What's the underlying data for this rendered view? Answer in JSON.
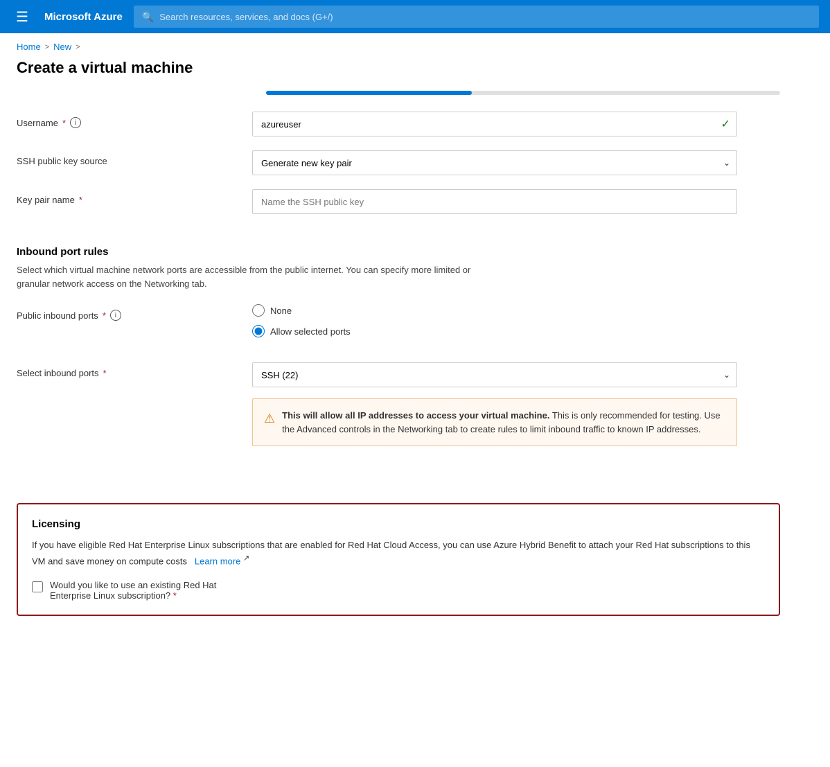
{
  "navbar": {
    "hamburger_label": "☰",
    "brand": "Microsoft Azure",
    "search_placeholder": "Search resources, services, and docs (G+/)"
  },
  "breadcrumb": {
    "home": "Home",
    "new": "New",
    "sep1": ">",
    "sep2": ">"
  },
  "page": {
    "title": "Create a virtual machine"
  },
  "form": {
    "username_label": "Username",
    "username_value": "azureuser",
    "ssh_source_label": "SSH public key source",
    "ssh_source_value": "Generate new key pair",
    "key_pair_label": "Key pair name",
    "key_pair_placeholder": "Name the SSH public key",
    "inbound_section_heading": "Inbound port rules",
    "inbound_description": "Select which virtual machine network ports are accessible from the public internet. You can specify more limited or granular network access on the Networking tab.",
    "public_inbound_label": "Public inbound ports",
    "radio_none": "None",
    "radio_allow": "Allow selected ports",
    "select_inbound_label": "Select inbound ports",
    "select_inbound_value": "SSH (22)",
    "warning_text_bold": "This will allow all IP addresses to access your virtual machine.",
    "warning_text": " This is only recommended for testing.  Use the Advanced controls in the Networking tab to create rules to limit inbound traffic to known IP addresses.",
    "licensing_title": "Licensing",
    "licensing_description": "If you have eligible Red Hat Enterprise Linux subscriptions that are enabled for Red Hat Cloud Access, you can use Azure Hybrid Benefit to attach your Red Hat subscriptions to this VM and save money on compute costs",
    "learn_more": "Learn more",
    "checkbox_label1": "Would you like to use an existing Red Hat",
    "checkbox_label2": "Enterprise Linux subscription?",
    "required_star": "*"
  },
  "icons": {
    "search": "🔍",
    "check": "✓",
    "chevron_down": "⌄",
    "warning": "⚠",
    "external_link": "↗"
  }
}
